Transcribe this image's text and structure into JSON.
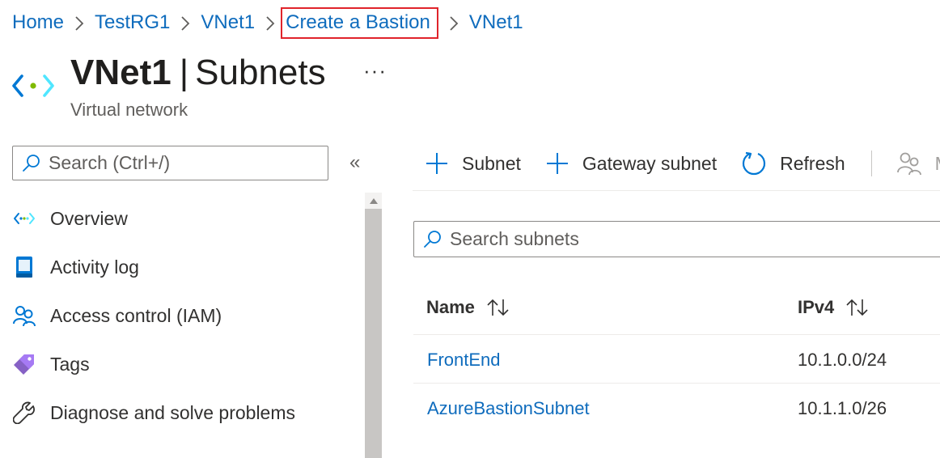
{
  "breadcrumb": [
    {
      "label": "Home"
    },
    {
      "label": "TestRG1"
    },
    {
      "label": "VNet1"
    },
    {
      "label": "Create a Bastion",
      "highlighted": true
    },
    {
      "label": "VNet1"
    }
  ],
  "header": {
    "resource_name": "VNet1",
    "separator": "|",
    "blade_name": "Subnets",
    "resource_type": "Virtual network",
    "more_label": "···",
    "icon": "virtual-network-icon"
  },
  "sidebar": {
    "search": {
      "placeholder": "Search (Ctrl+/)",
      "value": ""
    },
    "collapse_label": "«",
    "items": [
      {
        "label": "Overview",
        "icon": "virtual-network-icon"
      },
      {
        "label": "Activity log",
        "icon": "activity-log-icon"
      },
      {
        "label": "Access control (IAM)",
        "icon": "people-icon"
      },
      {
        "label": "Tags",
        "icon": "tag-icon"
      },
      {
        "label": "Diagnose and solve problems",
        "icon": "wrench-icon"
      }
    ]
  },
  "toolbar": {
    "add_subnet_label": "Subnet",
    "add_gateway_subnet_label": "Gateway subnet",
    "refresh_label": "Refresh",
    "truncated_label": "M"
  },
  "subnets": {
    "search": {
      "placeholder": "Search subnets",
      "value": ""
    },
    "columns": [
      {
        "label": "Name",
        "sort_icon": "sort-icon"
      },
      {
        "label": "IPv4",
        "sort_icon": "sort-icon"
      }
    ],
    "rows": [
      {
        "name": "FrontEnd",
        "ipv4": "10.1.0.0/24"
      },
      {
        "name": "AzureBastionSubnet",
        "ipv4": "10.1.1.0/26"
      }
    ]
  },
  "colors": {
    "link": "#0f6cbd",
    "highlight_border": "#e0242b",
    "accent_blue": "#0078d4"
  }
}
